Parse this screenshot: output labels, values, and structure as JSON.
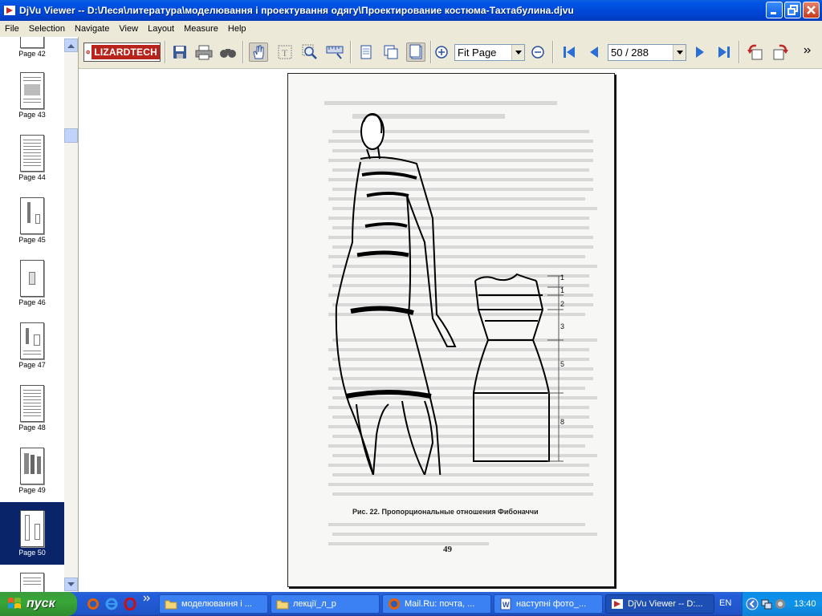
{
  "window": {
    "title": "DjVu Viewer -- D:\\Леся\\литература\\моделювання і проектування одягу\\Проектирование костюма-Тахтабулина.djvu"
  },
  "menu": [
    "File",
    "Selection",
    "Navigate",
    "View",
    "Layout",
    "Measure",
    "Help"
  ],
  "toolbar": {
    "logo_text": "LIZARDTECH",
    "zoom_value": "Fit Page",
    "page_value": "50 / 288"
  },
  "thumbnails": [
    {
      "label": "Page 42"
    },
    {
      "label": "Page 43"
    },
    {
      "label": "Page 44"
    },
    {
      "label": "Page 45"
    },
    {
      "label": "Page 46"
    },
    {
      "label": "Page 47"
    },
    {
      "label": "Page 48"
    },
    {
      "label": "Page 49"
    },
    {
      "label": "Page 50"
    }
  ],
  "document": {
    "caption": "Рис. 22. Пропорциональные отношения Фибоначчи",
    "page_number": "49",
    "scale_marks": [
      "1",
      "1",
      "2",
      "3",
      "5",
      "8"
    ]
  },
  "taskbar": {
    "start_label": "пуск",
    "tasks": [
      {
        "label": "моделювання і ..."
      },
      {
        "label": "лекції_л_р"
      },
      {
        "label": "Mail.Ru: почта, ..."
      },
      {
        "label": "наступні фото_..."
      },
      {
        "label": "DjVu Viewer -- D:..."
      }
    ],
    "language": "EN",
    "clock": "13:40"
  },
  "colors": {
    "titlebar": "#0054e3",
    "selected_thumbnail": "#0a246a",
    "taskbar": "#245edb",
    "start": "#37a637"
  }
}
